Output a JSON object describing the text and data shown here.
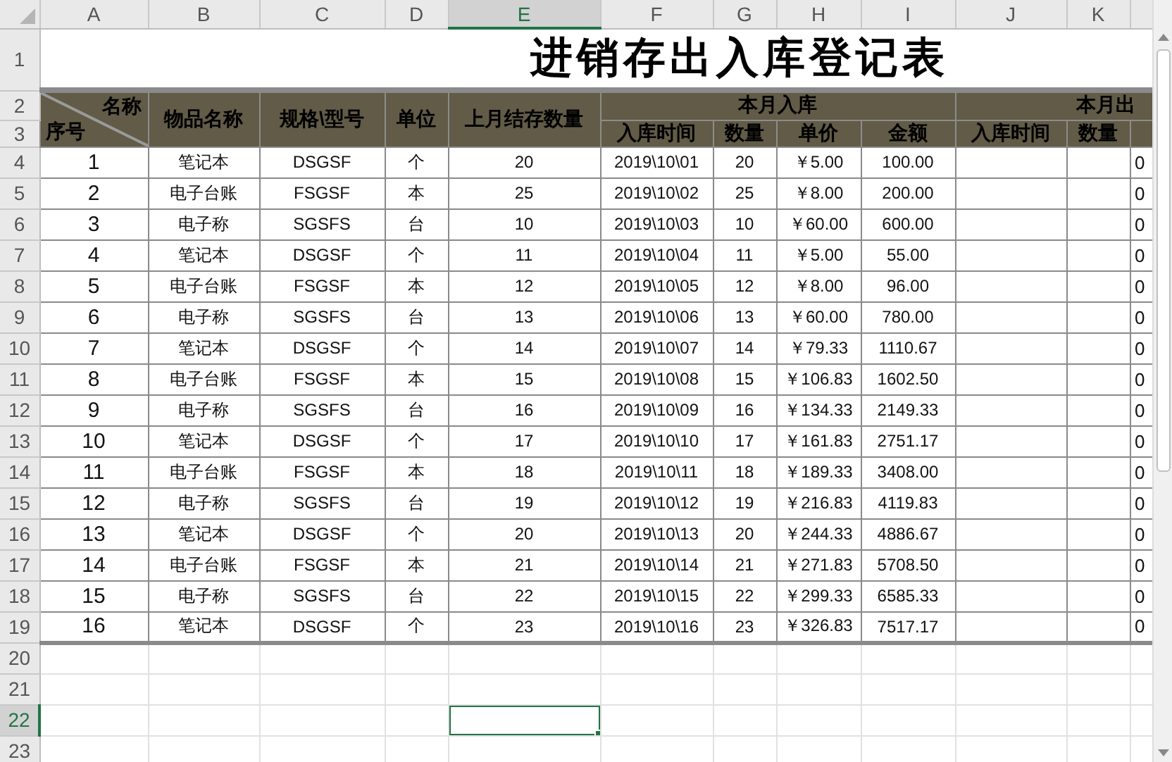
{
  "column_headers": [
    {
      "label": "A",
      "selected": false
    },
    {
      "label": "B",
      "selected": false
    },
    {
      "label": "C",
      "selected": false
    },
    {
      "label": "D",
      "selected": false
    },
    {
      "label": "E",
      "selected": true
    },
    {
      "label": "F",
      "selected": false
    },
    {
      "label": "G",
      "selected": false
    },
    {
      "label": "H",
      "selected": false
    },
    {
      "label": "I",
      "selected": false
    },
    {
      "label": "J",
      "selected": false
    },
    {
      "label": "K",
      "selected": false
    }
  ],
  "row_numbers": [
    {
      "label": "1",
      "selected": false
    },
    {
      "label": "2",
      "selected": false
    },
    {
      "label": "3",
      "selected": false
    },
    {
      "label": "4",
      "selected": false
    },
    {
      "label": "5",
      "selected": false
    },
    {
      "label": "6",
      "selected": false
    },
    {
      "label": "7",
      "selected": false
    },
    {
      "label": "8",
      "selected": false
    },
    {
      "label": "9",
      "selected": false
    },
    {
      "label": "10",
      "selected": false
    },
    {
      "label": "11",
      "selected": false
    },
    {
      "label": "12",
      "selected": false
    },
    {
      "label": "13",
      "selected": false
    },
    {
      "label": "14",
      "selected": false
    },
    {
      "label": "15",
      "selected": false
    },
    {
      "label": "16",
      "selected": false
    },
    {
      "label": "17",
      "selected": false
    },
    {
      "label": "18",
      "selected": false
    },
    {
      "label": "19",
      "selected": false
    },
    {
      "label": "20",
      "selected": false
    },
    {
      "label": "21",
      "selected": false
    },
    {
      "label": "22",
      "selected": true
    },
    {
      "label": "23",
      "selected": false
    }
  ],
  "title": "进销存出入库登记表",
  "header": {
    "diagonal_top": "名称",
    "diagonal_bottom": "序号",
    "columns": [
      "物品名称",
      "规格\\型号",
      "单位",
      "上月结存数量"
    ],
    "group_in": "本月入库",
    "in_columns": [
      "入库时间",
      "数量",
      "单价",
      "金额"
    ],
    "group_out": "本月出",
    "out_columns": [
      "入库时间",
      "数量"
    ]
  },
  "rows": [
    {
      "seq": "1",
      "name": "笔记本",
      "spec": "DSGSF",
      "unit": "个",
      "prev": "20",
      "date": "2019\\10\\01",
      "qty": "20",
      "price": "￥5.00",
      "amount": "100.00",
      "column_L": "0"
    },
    {
      "seq": "2",
      "name": "电子台账",
      "spec": "FSGSF",
      "unit": "本",
      "prev": "25",
      "date": "2019\\10\\02",
      "qty": "25",
      "price": "￥8.00",
      "amount": "200.00",
      "column_L": "0"
    },
    {
      "seq": "3",
      "name": "电子称",
      "spec": "SGSFS",
      "unit": "台",
      "prev": "10",
      "date": "2019\\10\\03",
      "qty": "10",
      "price": "￥60.00",
      "amount": "600.00",
      "column_L": "0"
    },
    {
      "seq": "4",
      "name": "笔记本",
      "spec": "DSGSF",
      "unit": "个",
      "prev": "11",
      "date": "2019\\10\\04",
      "qty": "11",
      "price": "￥5.00",
      "amount": "55.00",
      "column_L": "0"
    },
    {
      "seq": "5",
      "name": "电子台账",
      "spec": "FSGSF",
      "unit": "本",
      "prev": "12",
      "date": "2019\\10\\05",
      "qty": "12",
      "price": "￥8.00",
      "amount": "96.00",
      "column_L": "0"
    },
    {
      "seq": "6",
      "name": "电子称",
      "spec": "SGSFS",
      "unit": "台",
      "prev": "13",
      "date": "2019\\10\\06",
      "qty": "13",
      "price": "￥60.00",
      "amount": "780.00",
      "column_L": "0"
    },
    {
      "seq": "7",
      "name": "笔记本",
      "spec": "DSGSF",
      "unit": "个",
      "prev": "14",
      "date": "2019\\10\\07",
      "qty": "14",
      "price": "￥79.33",
      "amount": "1110.67",
      "column_L": "0"
    },
    {
      "seq": "8",
      "name": "电子台账",
      "spec": "FSGSF",
      "unit": "本",
      "prev": "15",
      "date": "2019\\10\\08",
      "qty": "15",
      "price": "￥106.83",
      "amount": "1602.50",
      "column_L": "0"
    },
    {
      "seq": "9",
      "name": "电子称",
      "spec": "SGSFS",
      "unit": "台",
      "prev": "16",
      "date": "2019\\10\\09",
      "qty": "16",
      "price": "￥134.33",
      "amount": "2149.33",
      "column_L": "0"
    },
    {
      "seq": "10",
      "name": "笔记本",
      "spec": "DSGSF",
      "unit": "个",
      "prev": "17",
      "date": "2019\\10\\10",
      "qty": "17",
      "price": "￥161.83",
      "amount": "2751.17",
      "column_L": "0"
    },
    {
      "seq": "11",
      "name": "电子台账",
      "spec": "FSGSF",
      "unit": "本",
      "prev": "18",
      "date": "2019\\10\\11",
      "qty": "18",
      "price": "￥189.33",
      "amount": "3408.00",
      "column_L": "0"
    },
    {
      "seq": "12",
      "name": "电子称",
      "spec": "SGSFS",
      "unit": "台",
      "prev": "19",
      "date": "2019\\10\\12",
      "qty": "19",
      "price": "￥216.83",
      "amount": "4119.83",
      "column_L": "0"
    },
    {
      "seq": "13",
      "name": "笔记本",
      "spec": "DSGSF",
      "unit": "个",
      "prev": "20",
      "date": "2019\\10\\13",
      "qty": "20",
      "price": "￥244.33",
      "amount": "4886.67",
      "column_L": "0"
    },
    {
      "seq": "14",
      "name": "电子台账",
      "spec": "FSGSF",
      "unit": "本",
      "prev": "21",
      "date": "2019\\10\\14",
      "qty": "21",
      "price": "￥271.83",
      "amount": "5708.50",
      "column_L": "0"
    },
    {
      "seq": "15",
      "name": "电子称",
      "spec": "SGSFS",
      "unit": "台",
      "prev": "22",
      "date": "2019\\10\\15",
      "qty": "22",
      "price": "￥299.33",
      "amount": "6585.33",
      "column_L": "0"
    },
    {
      "seq": "16",
      "name": "笔记本",
      "spec": "DSGSF",
      "unit": "个",
      "prev": "23",
      "date": "2019\\10\\16",
      "qty": "23",
      "price": "￥326.83",
      "amount": "7517.17",
      "column_L": "0"
    }
  ]
}
